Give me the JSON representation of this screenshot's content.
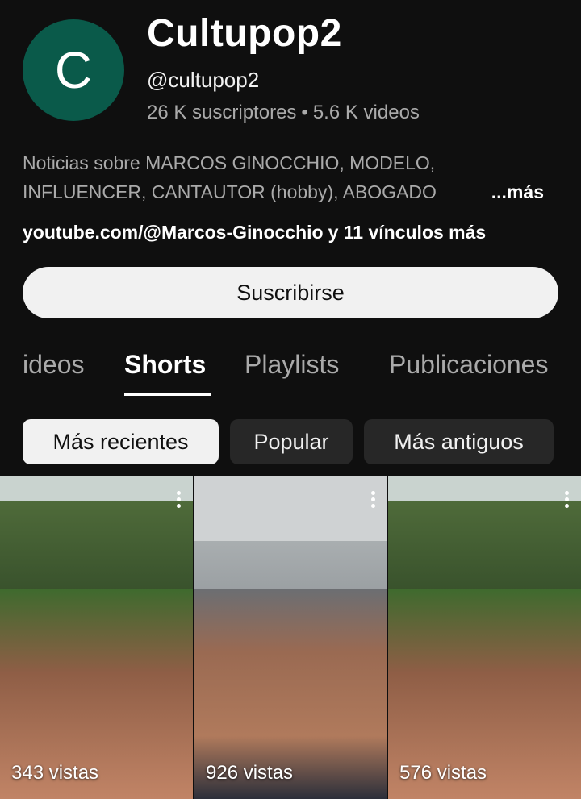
{
  "channel": {
    "avatar_letter": "C",
    "name": "Cultupop2",
    "handle": "@cultupop2",
    "subscribers": "26 K suscriptores",
    "separator": "•",
    "videos": "5.6 K videos",
    "description_line1": "Noticias sobre MARCOS GINOCCHIO, MODELO,",
    "description_line2": "INFLUENCER, CANTAUTOR (hobby), ABOGADO",
    "more_label": "...más",
    "link_text": "youtube.com/@Marcos-Ginocchio",
    "link_more": "y 11 vínculos más",
    "subscribe_label": "Suscribirse"
  },
  "tabs": [
    {
      "label": "ideos"
    },
    {
      "label": "Shorts"
    },
    {
      "label": "Playlists"
    },
    {
      "label": "Publicaciones"
    }
  ],
  "filters": [
    {
      "label": "Más recientes",
      "selected": true
    },
    {
      "label": "Popular",
      "selected": false
    },
    {
      "label": "Más antiguos",
      "selected": false
    }
  ],
  "shorts": [
    {
      "views": "343 vistas"
    },
    {
      "views": "926 vistas"
    },
    {
      "views": "576 vistas"
    }
  ],
  "icons": {
    "short_menu": "more-vert-icon"
  },
  "colors": {
    "background": "#0f0f0f",
    "avatar": "#0a5a4a",
    "subscribe_bg": "#f1f1f1"
  }
}
